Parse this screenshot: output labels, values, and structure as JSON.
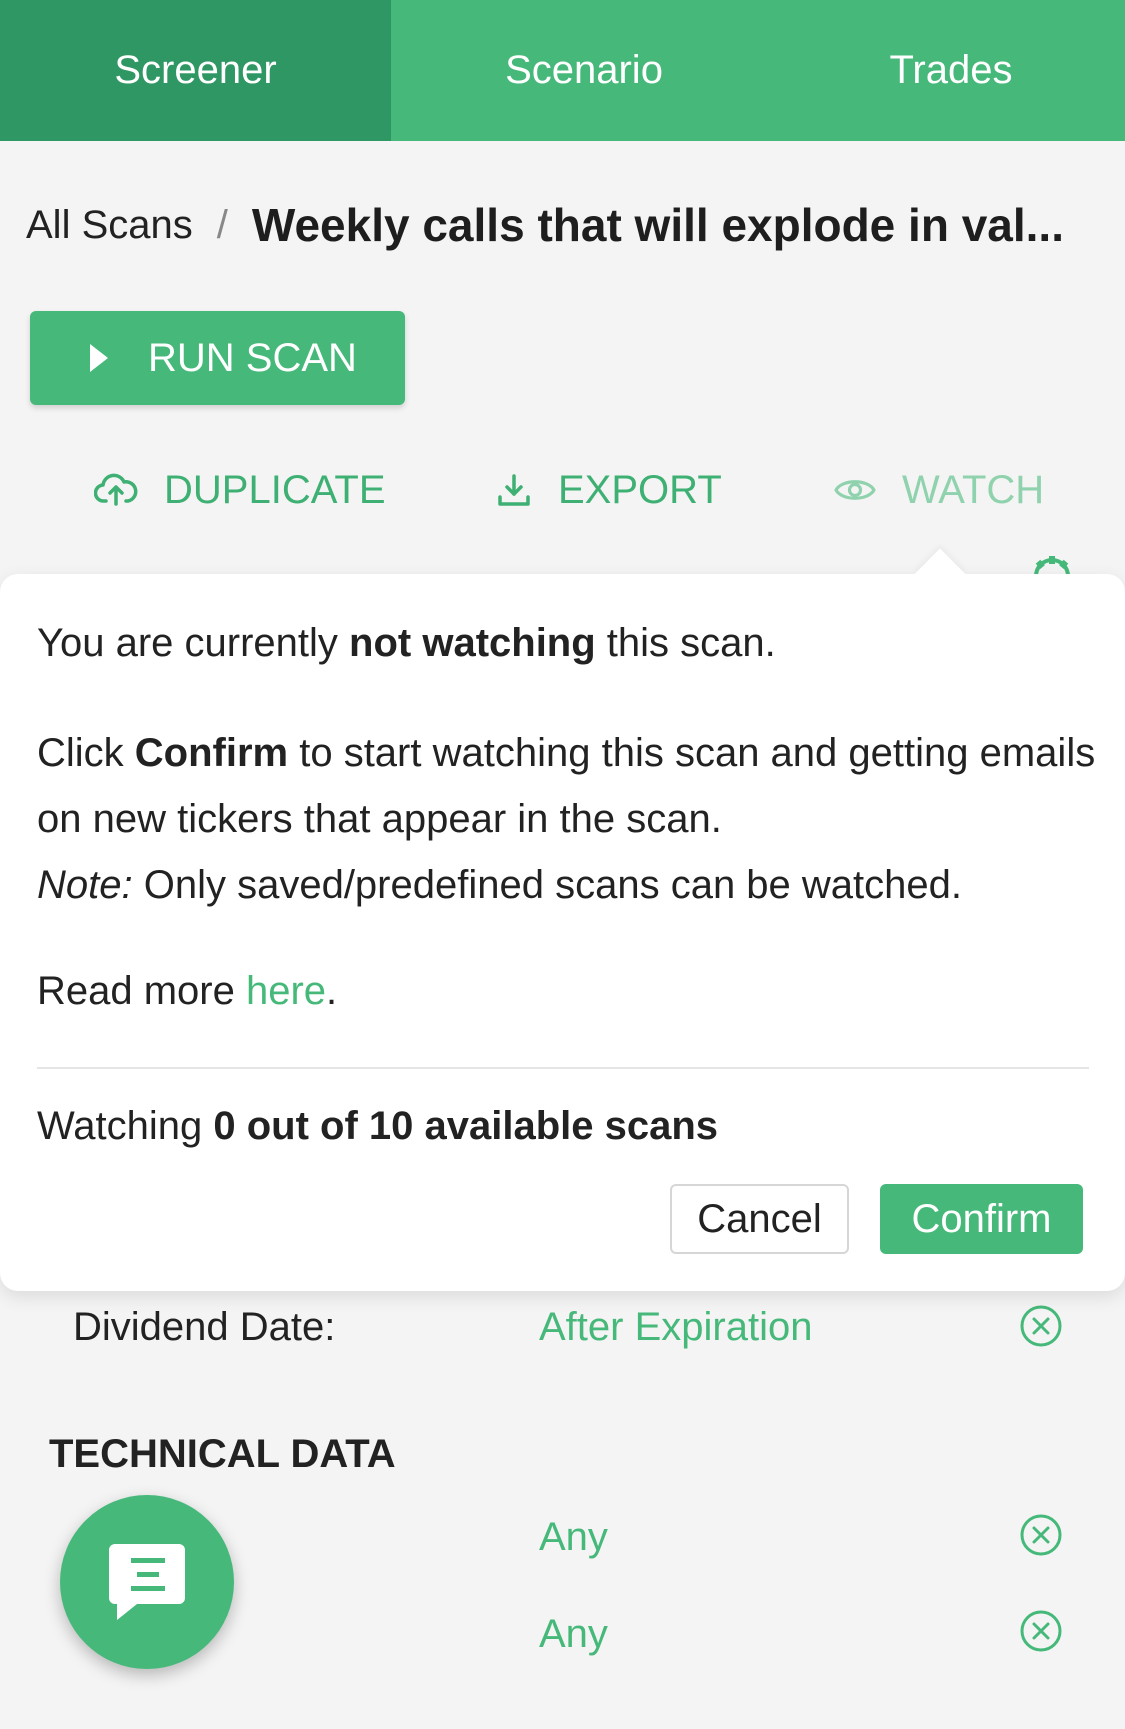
{
  "tabs": [
    {
      "label": "Screener",
      "active": true
    },
    {
      "label": "Scenario",
      "active": false
    },
    {
      "label": "Trades",
      "active": false
    }
  ],
  "breadcrumb": {
    "root": "All Scans",
    "separator": "/",
    "title": "Weekly calls that will explode in val..."
  },
  "actions": {
    "run_scan": "RUN SCAN",
    "duplicate": "DUPLICATE",
    "export": "EXPORT",
    "watch": "WATCH"
  },
  "popup": {
    "line1_pre": "You are currently ",
    "line1_bold": "not watching",
    "line1_post": " this scan.",
    "line2_pre": "Click ",
    "line2_bold": "Confirm",
    "line2_post": " to start watching this scan and getting emails on new tickers that appear in the scan.",
    "note_label": "Note:",
    "note_text": " Only saved/predefined scans can be watched.",
    "read_more_pre": "Read more ",
    "read_more_link": "here",
    "read_more_post": ".",
    "watching_pre": "Watching ",
    "watching_bold": "0 out of 10 available scans",
    "cancel": "Cancel",
    "confirm": "Confirm"
  },
  "filters": {
    "dividend_label": "Dividend Date:",
    "dividend_value": "After Expiration",
    "section_technical": "TECHNICAL DATA",
    "row1_value": "Any",
    "row2_value": "Any"
  },
  "colors": {
    "brand": "#46b97a",
    "brand_dark": "#2f9763"
  },
  "icons": {
    "duplicate": "cloud-upload-icon",
    "export": "download-icon",
    "watch": "eye-icon",
    "clear": "close-circle-icon",
    "fab": "chat-icon"
  }
}
